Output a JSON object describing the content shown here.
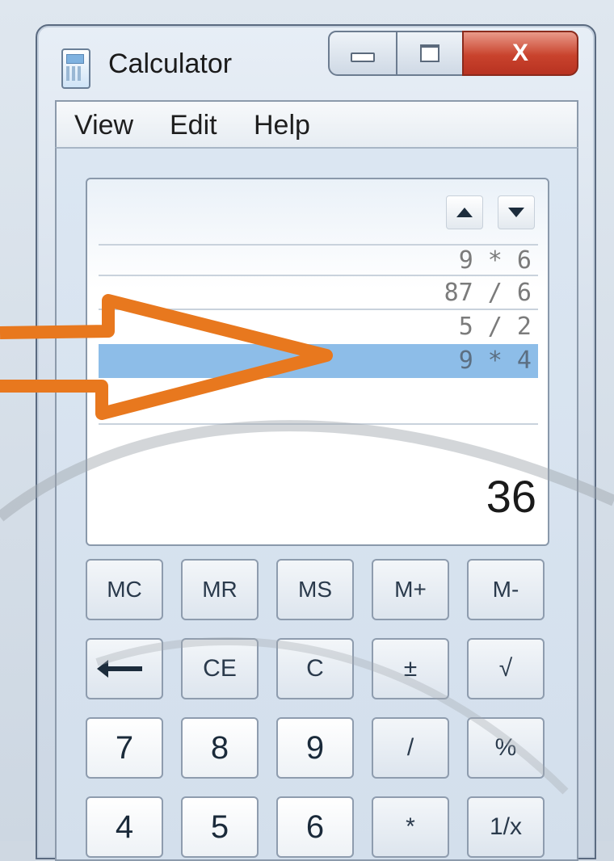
{
  "window": {
    "title": "Calculator",
    "close_glyph": "X"
  },
  "menu": {
    "items": [
      "View",
      "Edit",
      "Help"
    ]
  },
  "history": {
    "rows": [
      "9 * 6",
      "87 / 6",
      "5 / 2",
      "9 * 4"
    ],
    "selected_index": 3
  },
  "display": {
    "result": "36"
  },
  "keypad": {
    "memory": [
      "MC",
      "MR",
      "MS",
      "M+",
      "M-"
    ],
    "row2": [
      "CE",
      "C",
      "±",
      "√"
    ],
    "row3": [
      "7",
      "8",
      "9",
      "/",
      "%"
    ],
    "row4": [
      "4",
      "5",
      "6",
      "*",
      "1/x"
    ]
  },
  "annotation": {
    "arrow_color": "#e8781e",
    "highlight_color": "#8dbde8"
  },
  "icons": [
    "calculator-icon",
    "minimize-icon",
    "maximize-icon",
    "close-icon",
    "history-up-icon",
    "history-down-icon",
    "backspace-icon"
  ]
}
